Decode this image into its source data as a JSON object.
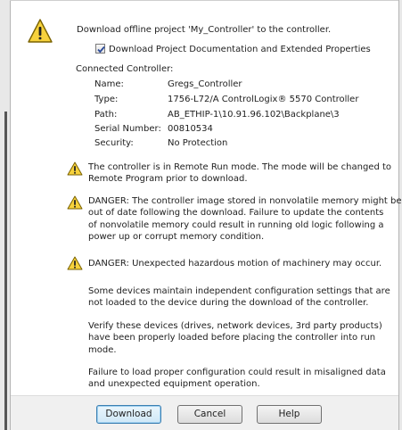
{
  "header": {
    "message": "Download offline project 'My_Controller' to the controller.",
    "checkbox_label": "Download Project Documentation and Extended Properties",
    "checkbox_checked": true
  },
  "controller": {
    "section_label": "Connected Controller:",
    "fields": [
      {
        "label": "Name:",
        "value": "Gregs_Controller"
      },
      {
        "label": "Type:",
        "value": "1756-L72/A ControlLogix® 5570 Controller"
      },
      {
        "label": "Path:",
        "value": "AB_ETHIP-1\\10.91.96.102\\Backplane\\3"
      },
      {
        "label": "Serial Number:",
        "value": "00810534"
      },
      {
        "label": "Security:",
        "value": "No Protection"
      }
    ]
  },
  "warnings": {
    "remote_run": [
      "The controller is in Remote Run mode. The mode will be changed to",
      "Remote Program prior to download."
    ],
    "nonvolatile": [
      "DANGER: The controller image stored in nonvolatile memory might be",
      "out of date following the download. Failure to update the contents",
      "of nonvolatile memory could result in running old logic following a",
      "power up or corrupt memory condition."
    ],
    "motion": [
      "DANGER: Unexpected hazardous motion of machinery may occur."
    ]
  },
  "notes": {
    "config": [
      "Some devices maintain independent configuration settings that are",
      "not loaded to the device during the download of the controller."
    ],
    "verify": [
      "Verify these devices (drives, network devices, 3rd party products)",
      "have been properly loaded before placing the controller into run",
      "mode."
    ],
    "failure": [
      "Failure to load proper configuration could result in misaligned data",
      "and unexpected equipment operation."
    ]
  },
  "buttons": {
    "download": "Download",
    "cancel": "Cancel",
    "help": "Help"
  },
  "colors": {
    "warning_yellow": "#f7d23c",
    "warning_border": "#7a6200",
    "default_button_border": "#3c7fb1"
  }
}
